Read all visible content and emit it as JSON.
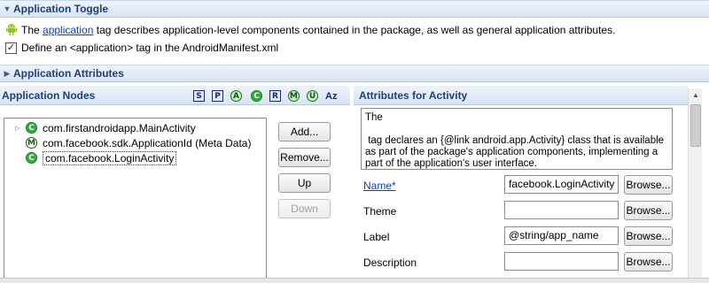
{
  "toggle_section": {
    "title": "Application Toggle",
    "desc_prefix": "The",
    "desc_link": "application",
    "desc_suffix": "tag describes application-level components contained in the package, as well as general application attributes.",
    "checkbox_label": "Define an <application> tag in the AndroidManifest.xml",
    "checked": true
  },
  "attributes_section": {
    "title": "Application Attributes"
  },
  "nodes_pane": {
    "title": "Application Nodes",
    "toolbar": [
      "S",
      "P",
      "A",
      "C",
      "R",
      "M",
      "U",
      "Az"
    ],
    "nodes": [
      {
        "label": "com.firstandroidapp.MainActivity",
        "icon": "activity-icon",
        "letter": "C",
        "expandable": true,
        "selected": false
      },
      {
        "label": "com.facebook.sdk.ApplicationId (Meta Data)",
        "icon": "meta-data-icon",
        "letter": "M",
        "expandable": false,
        "selected": false
      },
      {
        "label": "com.facebook.LoginActivity",
        "icon": "activity-icon",
        "letter": "C",
        "expandable": false,
        "selected": true
      }
    ],
    "buttons": {
      "add": "Add...",
      "remove": "Remove...",
      "up": "Up",
      "down": "Down"
    }
  },
  "activity_pane": {
    "title": "Attributes for Activity",
    "description_lines": [
      "The",
      "",
      " tag declares an {@link android.app.Activity} class that is available",
      "as part of the package's application components, implementing a",
      "part of the application's user interface."
    ],
    "browse_label": "Browse...",
    "fields": [
      {
        "label": "Name*",
        "value": "facebook.LoginActivity",
        "is_link": true
      },
      {
        "label": "Theme",
        "value": "",
        "is_link": false
      },
      {
        "label": "Label",
        "value": "@string/app_name",
        "is_link": false
      },
      {
        "label": "Description",
        "value": "",
        "is_link": false
      }
    ]
  },
  "colors": {
    "header_text": "#1f3f7a",
    "link": "#0b3fbf",
    "activity_icon": "#2fae39"
  }
}
